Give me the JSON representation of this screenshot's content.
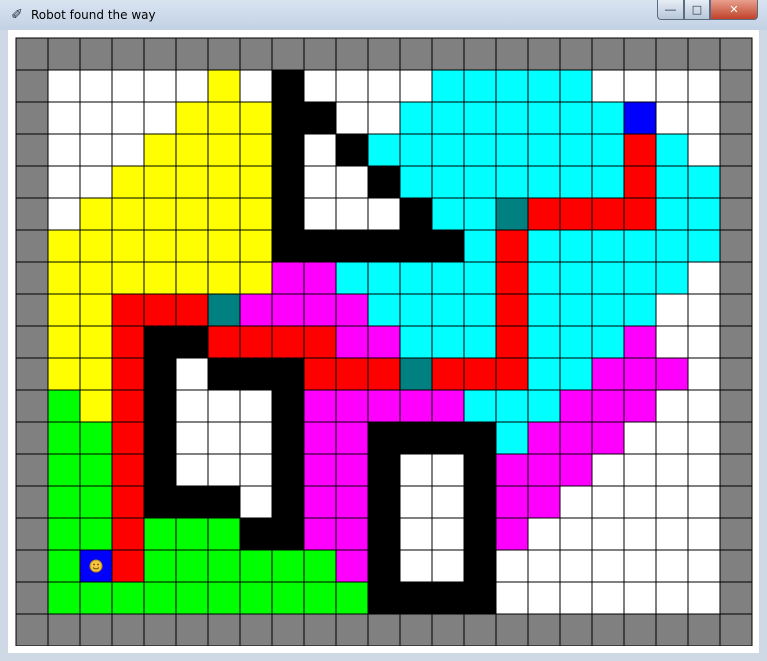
{
  "window": {
    "title": "Robot found the way",
    "controls": {
      "minimize_icon": "minimize-icon",
      "maximize_icon": "maximize-icon",
      "close_icon": "close-icon"
    }
  },
  "maze": {
    "rows": 18,
    "cols": 23,
    "colors": {
      "G": "#808080",
      "W": "#ffffff",
      "K": "#000000",
      "Y": "#ffff00",
      "C": "#00ffff",
      "M": "#ff00ff",
      "R": "#ff0000",
      "L": "#00ff00",
      "B": "#0000ff",
      "T": "#008080"
    },
    "legend": {
      "G": "border wall",
      "W": "open floor",
      "K": "obstacle",
      "Y": "explored region",
      "C": "explored region",
      "M": "explored region",
      "L": "explored region",
      "R": "found path",
      "B": "start/goal",
      "T": "junction"
    },
    "grid": [
      "GGGGGGGGGGGGGGGGGGGGGGG",
      "GWWWWWYWKWWWWCCCCCWWWWG",
      "GWWWWYYYKKWWCCCCCCCBWWG",
      "GWWWYYYYKWKCCCCCCCCRCWG",
      "GWWYYYYYKWWKCCCCCCCRCCG",
      "GWYYYYYYKWWWKCCTRRRRCCG",
      "GYYYYYYYKKKKKKCRCCCCCCG",
      "GYYYYYYYMMCCCCCRCCCCCWG",
      "GYYRRRTMMMMCCCCRCCCCWWG",
      "GYYRKKRRRRMMCCCRCCCMWWG",
      "GYYRKWKKKRRRTRRRCCMMMWG",
      "GLYRKWWWKMMMMMCCCMMMWWG",
      "GLLRKWWWKMMKKKKCMMMWWWG",
      "GLLRKWWWKMMKWWKMMMWWWWG",
      "GLLRKKKWKMMKWWKMMWWWWWG",
      "GLLRLLLKKMMKWWKMWWWWWWG",
      "GLBRLLLLLLMKWWKWWWWWWWG",
      "GLLLLLLLLLLKKKKWWWWWWWG",
      "GGGGGGGGGGGGGGGGGGGGGGG"
    ],
    "robot": {
      "row": 16,
      "col": 2,
      "icon": "smiley-face-icon"
    }
  }
}
